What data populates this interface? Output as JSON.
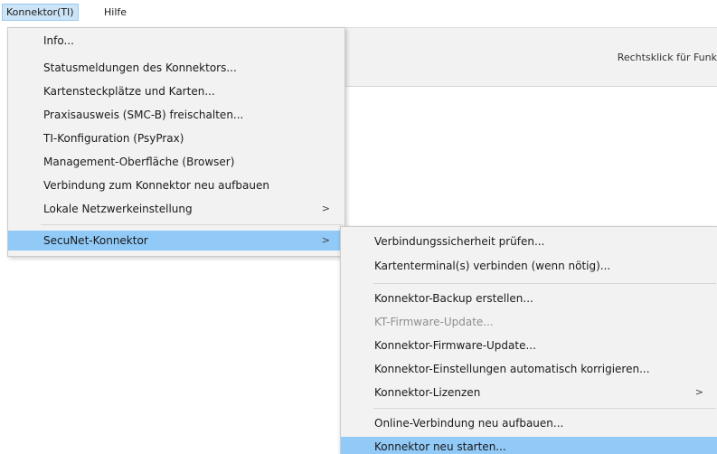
{
  "menubar": {
    "items": [
      "Konnektor(TI)",
      "Hilfe"
    ]
  },
  "background": {
    "header_text": "Rechtsklick für Funk"
  },
  "main_menu": {
    "items": [
      {
        "label": "Info..."
      },
      {
        "label": "Statusmeldungen des Konnektors..."
      },
      {
        "label": "Kartensteckplätze und Karten..."
      },
      {
        "label": "Praxisausweis (SMC-B) freischalten..."
      },
      {
        "label": "TI-Konfiguration (PsyPrax)"
      },
      {
        "label": "Management-Oberfläche (Browser)"
      },
      {
        "label": "Verbindung zum Konnektor neu aufbauen"
      },
      {
        "label": "Lokale Netzwerkeinstellung",
        "submenu_indicator": ">"
      },
      {
        "label": "SecuNet-Konnektor",
        "submenu_indicator": ">",
        "highlighted": true
      }
    ]
  },
  "sub_menu": {
    "items": [
      {
        "label": "Verbindungssicherheit prüfen..."
      },
      {
        "label": "Kartenterminal(s) verbinden (wenn nötig)..."
      },
      {
        "label": "Konnektor-Backup erstellen..."
      },
      {
        "label": "KT-Firmware-Update...",
        "disabled": true
      },
      {
        "label": "Konnektor-Firmware-Update..."
      },
      {
        "label": "Konnektor-Einstellungen automatisch korrigieren..."
      },
      {
        "label": "Konnektor-Lizenzen",
        "submenu_indicator": ">"
      },
      {
        "label": "Online-Verbindung neu aufbauen..."
      },
      {
        "label": "Konnektor neu starten...",
        "highlighted": true
      }
    ]
  },
  "colors": {
    "menu_background": "#f2f2f2",
    "highlight": "#91c9f7",
    "menubar_active": "#cce4f7",
    "disabled_text": "#8f8f8f"
  }
}
